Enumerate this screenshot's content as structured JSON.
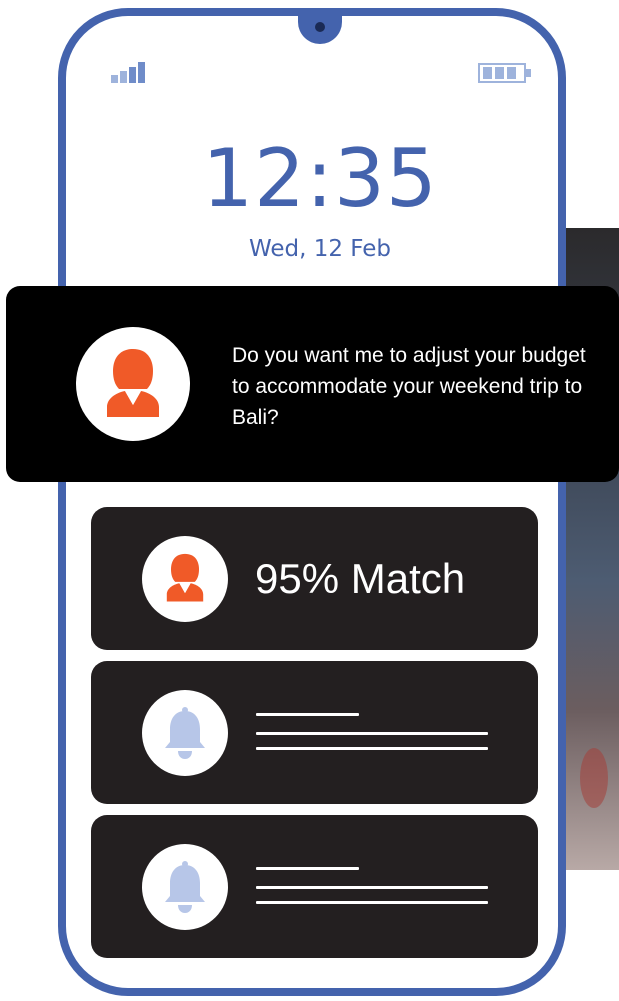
{
  "status_bar": {
    "signal_icon": "signal-bars-icon",
    "battery_icon": "battery-icon"
  },
  "lock_screen": {
    "time": "12:35",
    "date": "Wed, 12 Feb"
  },
  "popup_notification": {
    "avatar_icon": "assistant-avatar-icon",
    "message": "Do you want me to adjust your budget to accommodate your weekend trip to Bali?"
  },
  "notifications": [
    {
      "icon": "assistant-avatar-icon",
      "text": "95% Match"
    },
    {
      "icon": "bell-icon",
      "text": ""
    },
    {
      "icon": "bell-icon",
      "text": ""
    }
  ],
  "colors": {
    "accent": "#4463ad",
    "avatar": "#f05a28",
    "card": "#231f20",
    "bell": "#b7c6e8"
  }
}
